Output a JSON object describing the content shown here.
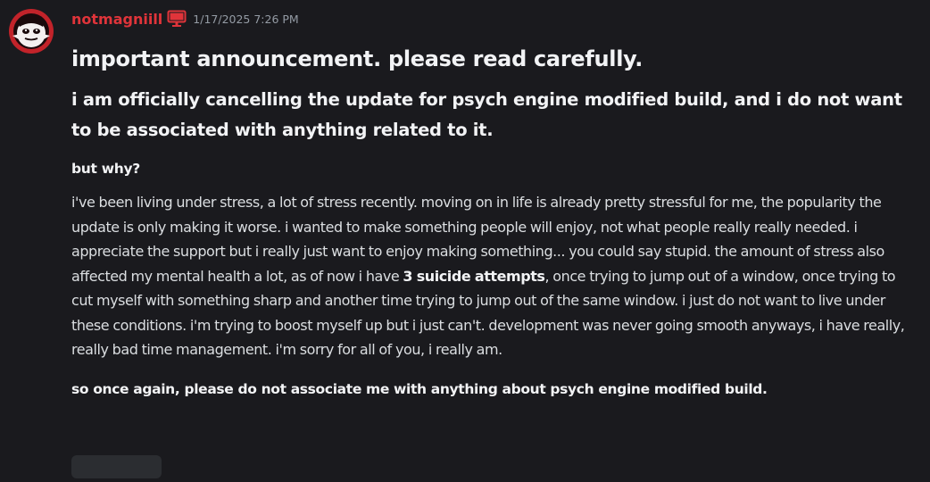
{
  "message": {
    "author": "notmagniill",
    "author_color": "#e0343a",
    "badge_icon": "monitor-icon",
    "timestamp": "1/17/2025 7:26 PM",
    "heading_1": "important announcement. please read carefully.",
    "heading_2": "i am officially cancelling the update for psych engine modified build, and i do not want to be associated with anything related to it.",
    "heading_3": "but why?",
    "body_before_bold": "i've been living under stress, a lot of stress recently. moving on in life is already pretty stressful for me, the popularity the update is only making it worse. i wanted to make something people will enjoy, not what people really really needed. i appreciate the support but i really just want to enjoy making something... you could say stupid. the amount of stress also affected my mental health a lot, as of now i have ",
    "body_bold": "3 suicide attempts",
    "body_after_bold": ", once trying to jump out of a window, once trying to cut myself with something sharp and another time trying to jump out of the same window. i just do not want to live under these conditions. i'm trying to boost myself up but i just can't. development was never going smooth anyways, i have really, really bad time management. i'm sorry for all of you, i really am.",
    "closing": "so once again, please do not associate me with anything about psych engine modified build."
  },
  "colors": {
    "background": "#1a1a1e",
    "text": "#dbdee1",
    "heading": "#f2f3f5",
    "timestamp": "#949ba4",
    "reaction_pill": "#2b2d31"
  }
}
